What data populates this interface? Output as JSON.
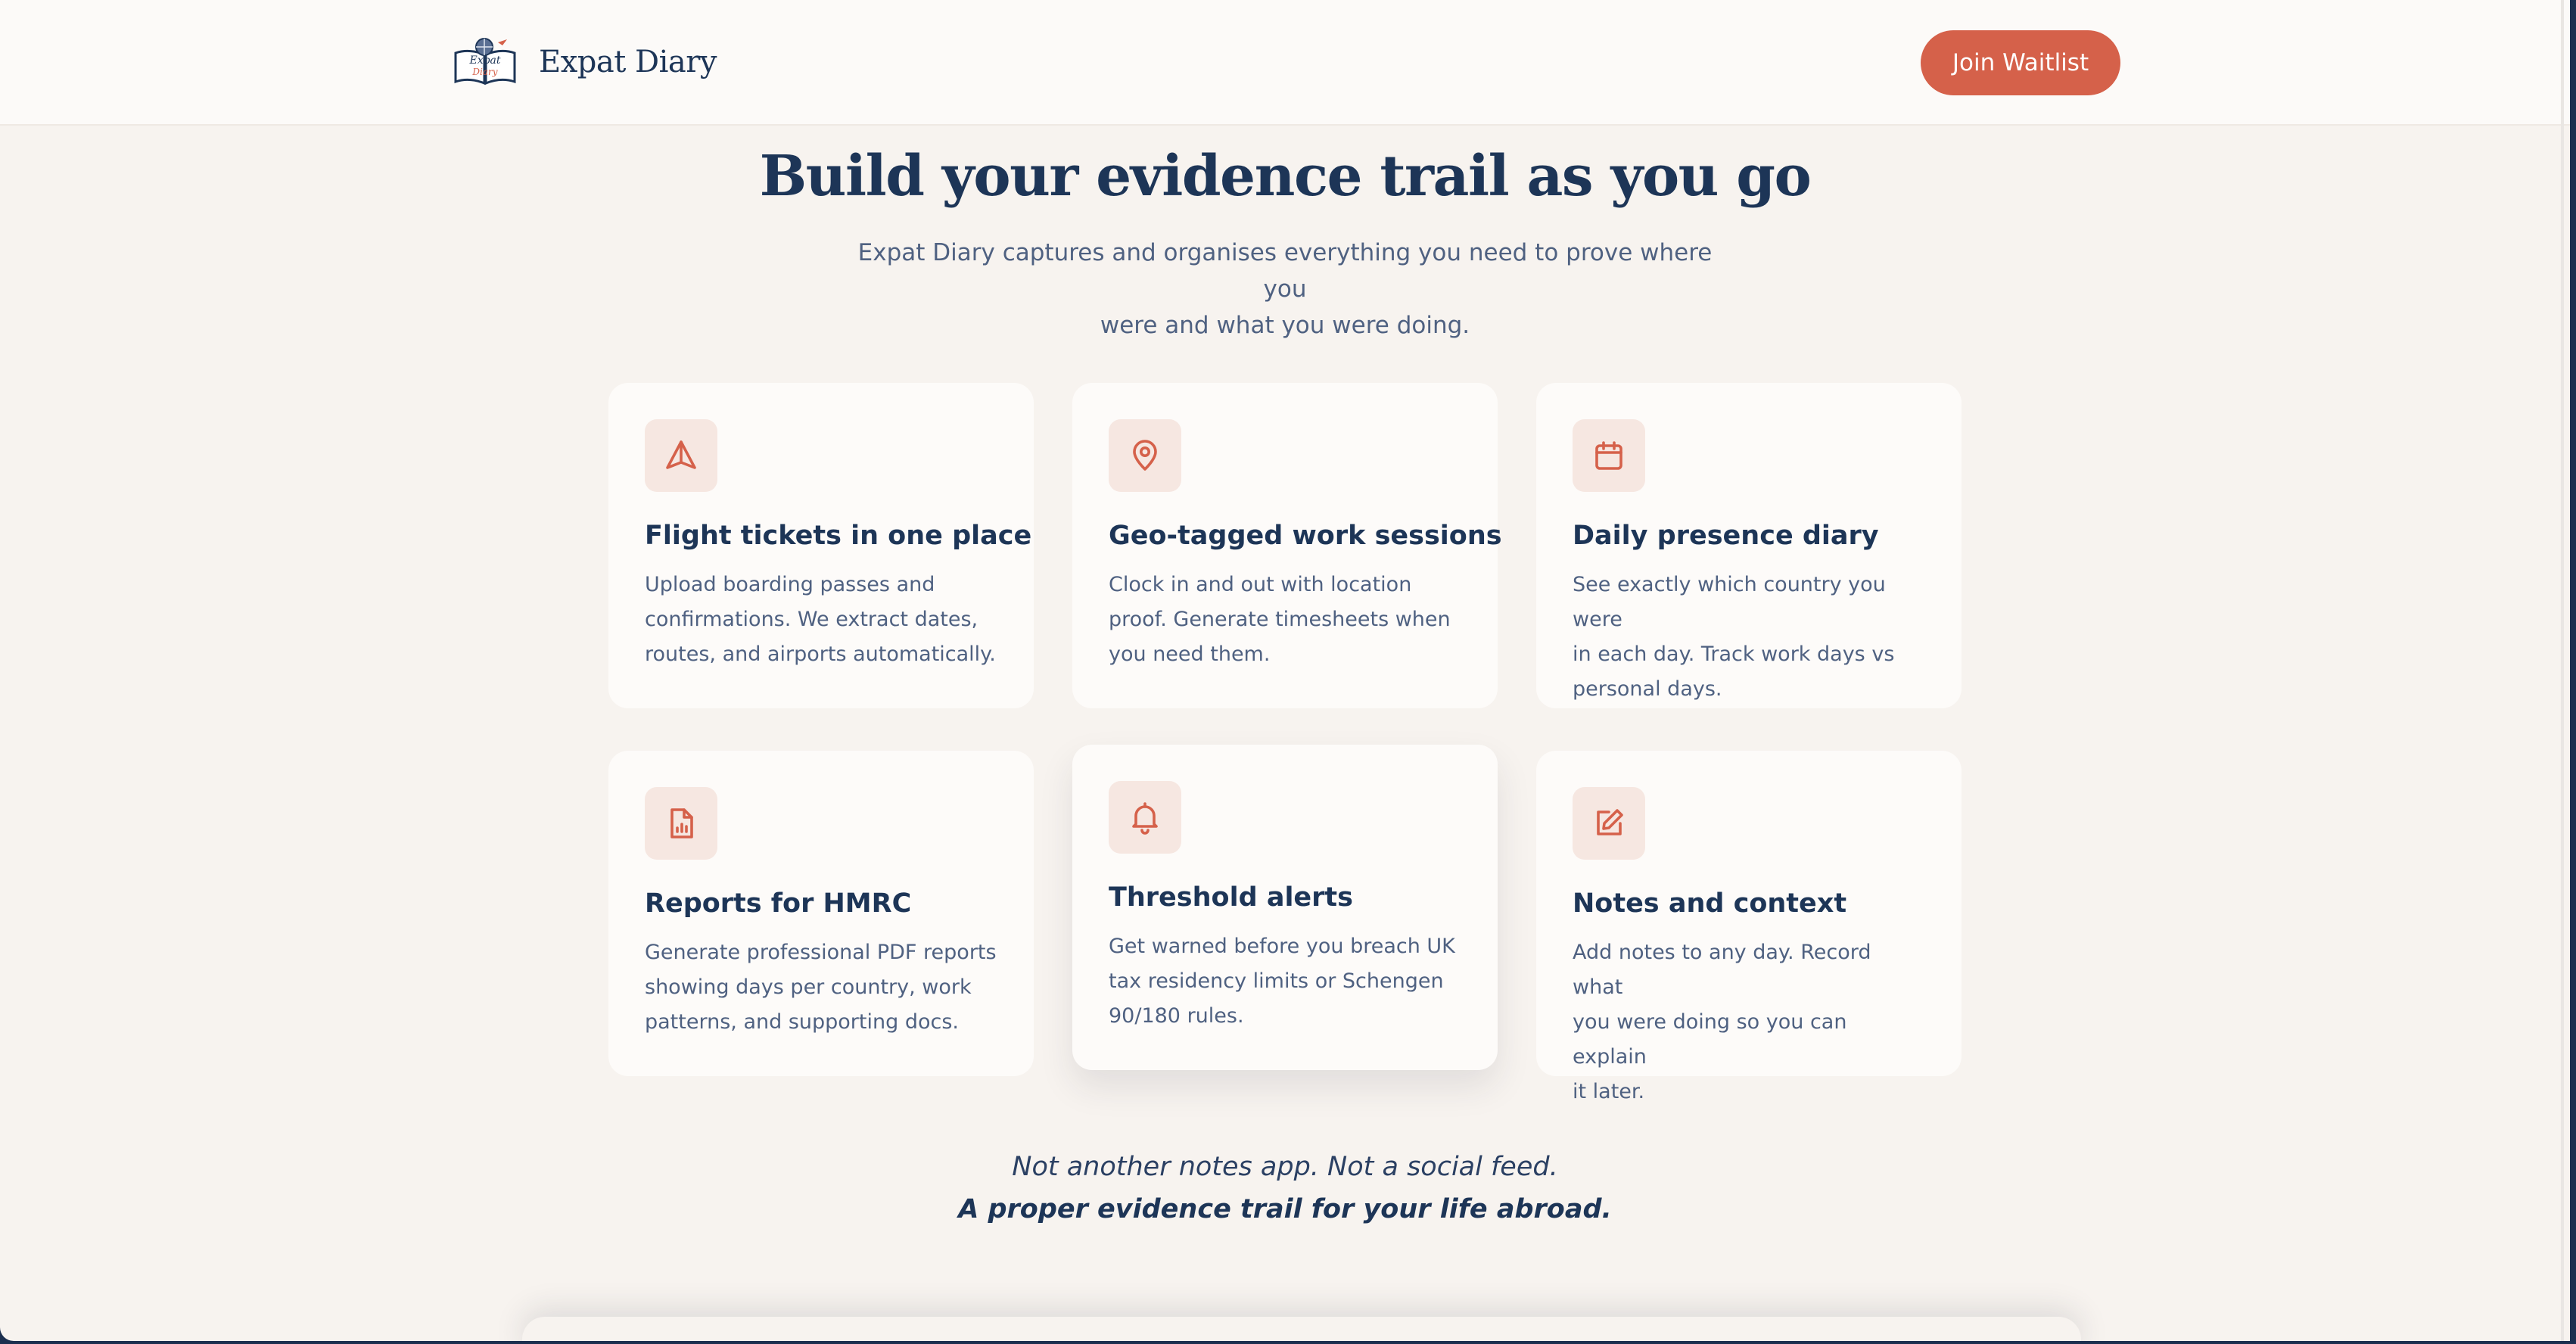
{
  "header": {
    "brand_name": "Expat Diary",
    "logo_text_top": "Expat",
    "logo_text_bottom": "Diary",
    "cta_label": "Join Waitlist"
  },
  "hero": {
    "title": "Build your evidence trail as you go",
    "subtitle_line1": "Expat Diary captures and organises everything you need to prove where you",
    "subtitle_line2": "were and what you were doing."
  },
  "features": [
    {
      "icon": "send-triangle-icon",
      "title": "Flight tickets in one place",
      "desc_lines": [
        "Upload boarding passes and",
        "confirmations. We extract dates,",
        "routes, and airports automatically."
      ]
    },
    {
      "icon": "map-pin-icon",
      "title": "Geo-tagged work sessions",
      "desc_lines": [
        "Clock in and out with location",
        "proof. Generate timesheets when",
        "you need them."
      ]
    },
    {
      "icon": "calendar-icon",
      "title": "Daily presence diary",
      "desc_lines": [
        "See exactly which country you were",
        "in each day. Track work days vs",
        "personal days."
      ]
    },
    {
      "icon": "document-chart-icon",
      "title": "Reports for HMRC",
      "desc_lines": [
        "Generate professional PDF reports",
        "showing days per country, work",
        "patterns, and supporting docs."
      ]
    },
    {
      "icon": "bell-icon",
      "title": "Threshold alerts",
      "desc_lines": [
        "Get warned before you breach UK",
        "tax residency limits or Schengen",
        "90/180 rules."
      ]
    },
    {
      "icon": "edit-icon",
      "title": "Notes and context",
      "desc_lines": [
        "Add notes to any day. Record what",
        "you were doing so you can explain",
        "it later."
      ]
    }
  ],
  "tagline": {
    "line1": "Not another notes app. Not a social feed.",
    "line2": "A proper evidence trail for your life abroad."
  },
  "colors": {
    "accent": "#d5614a",
    "navy": "#1d3557",
    "background": "#f7f3ef",
    "icon_bg": "#f6e7e1"
  }
}
